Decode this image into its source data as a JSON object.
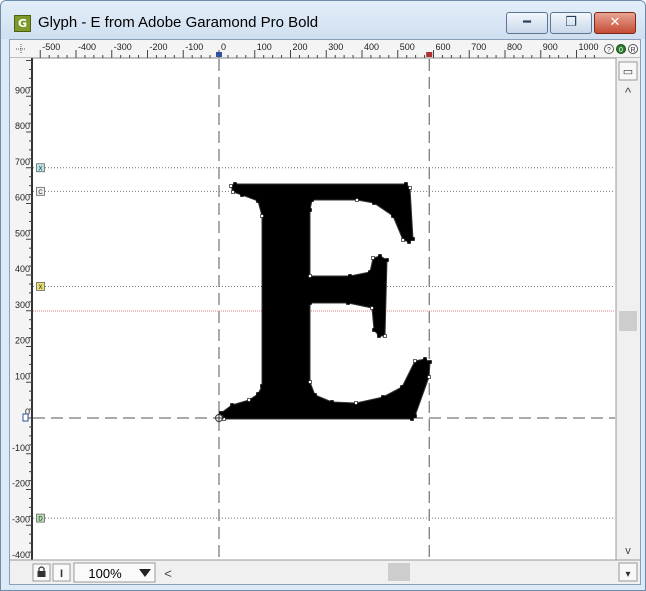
{
  "window": {
    "app_icon_letter": "G",
    "title": "Glyph - E from Adobe Garamond Pro Bold",
    "minimize_glyph": "━",
    "maximize_glyph": "❐",
    "close_glyph": "✕"
  },
  "ruler": {
    "horizontal_labels": [
      "-500",
      "-400",
      "-300",
      "-200",
      "-100",
      "0",
      "100",
      "200",
      "300",
      "400",
      "500",
      "600",
      "700",
      "800",
      "900",
      "1000"
    ],
    "vertical_labels": [
      "900",
      "800",
      "700",
      "600",
      "500",
      "400",
      "300",
      "200",
      "100",
      "0",
      "-100",
      "-200",
      "-300",
      "-400"
    ],
    "status_icons": [
      "?",
      "0",
      "R"
    ]
  },
  "guides": {
    "markers": [
      {
        "label": "X",
        "value": 700
      },
      {
        "label": "C",
        "value": 634
      },
      {
        "label": "X",
        "value": 368
      },
      {
        "label": "D",
        "value": -280
      }
    ],
    "vertical_metrics": [
      0,
      588
    ]
  },
  "glyph": {
    "name": "E",
    "font": "Adobe Garamond Pro Bold"
  },
  "bottom_bar": {
    "lock_label": "🔒",
    "italic_label": "I",
    "zoom_value": "100%",
    "left_arrow": "<"
  },
  "scrollbar": {
    "up": "^",
    "down": "v",
    "top_button": "▭",
    "corner": "▾"
  },
  "colors": {
    "baseline": "#555555",
    "guide": "#777777",
    "highlight_guide": "#e08080",
    "glyph": "#000000"
  }
}
